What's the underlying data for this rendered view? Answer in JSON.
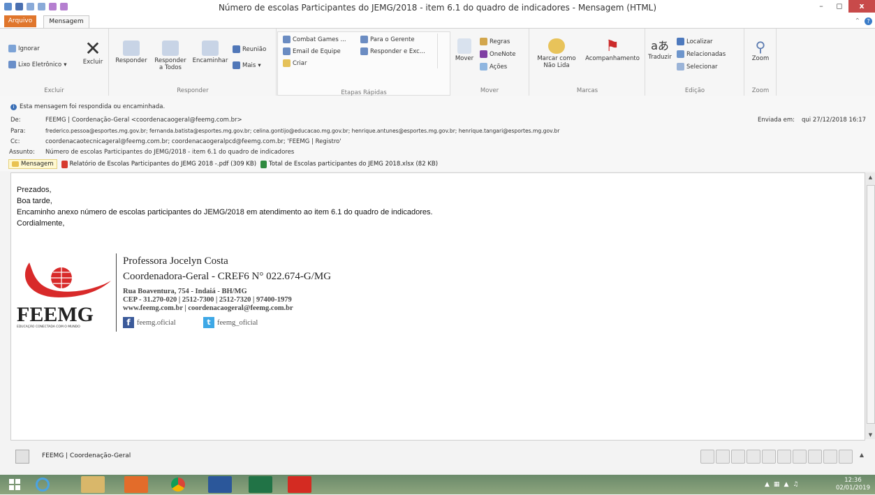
{
  "window": {
    "title": "Número de escolas Participantes do JEMG/2018 - item 6.1 do quadro de indicadores - Mensagem (HTML)",
    "close_label": "x"
  },
  "tabs": {
    "arquivo": "Arquivo",
    "mensagem": "Mensagem"
  },
  "ribbon": {
    "groups": {
      "excluir": "Excluir",
      "responder": "Responder",
      "etapas": "Etapas Rápidas",
      "mover": "Mover",
      "marcas": "Marcas",
      "edicao": "Edição",
      "zoom": "Zoom"
    },
    "ignorar": "Ignorar",
    "lixo": "Lixo Eletrônico",
    "excluir": "Excluir",
    "responder": "Responder",
    "responder_todos_1": "Responder",
    "responder_todos_2": "a Todos",
    "encaminhar": "Encaminhar",
    "reuniao": "Reunião",
    "mais": "Mais",
    "combat": "Combat Games ...",
    "email_equipe": "Email de Equipe",
    "criar": "Criar",
    "para_gerente": "Para o Gerente",
    "responder_exc": "Responder e Exc...",
    "mover": "Mover",
    "regras": "Regras",
    "onenote": "OneNote",
    "acoes": "Ações",
    "marcar_1": "Marcar como",
    "marcar_2": "Não Lida",
    "acompanhamento": "Acompanhamento",
    "traduzir": "Traduzir",
    "localizar": "Localizar",
    "relacionadas": "Relacionadas",
    "selecionar": "Selecionar",
    "zoom": "Zoom"
  },
  "header": {
    "info": "Esta mensagem foi respondida ou encaminhada.",
    "de_label": "De:",
    "de": "FEEMG | Coordenação-Geral <coordenacaogeral@feemg.com.br>",
    "enviada_label": "Enviada em:",
    "enviada": "qui 27/12/2018 16:17",
    "para_label": "Para:",
    "para": "frederico.pessoa@esportes.mg.gov.br; fernanda.batista@esportes.mg.gov.br; celina.gontijo@educacao.mg.gov.br; henrique.antunes@esportes.mg.gov.br; henrique.tangari@esportes.mg.gov.br",
    "cc_label": "Cc:",
    "cc": "coordenacaotecnicageral@feemg.com.br; coordenacaogeralpcd@feemg.com.br; 'FEEMG | Registro'",
    "assunto_label": "Assunto:",
    "assunto": "Número de escolas Participantes do JEMG/2018 - item 6.1 do quadro de indicadores"
  },
  "attachments": [
    "Mensagem",
    "Relatório de Escolas Participantes do JEMG 2018 -.pdf (309 KB)",
    "Total de Escolas participantes do JEMG 2018.xlsx (82 KB)"
  ],
  "body": {
    "line1": "Prezados,",
    "line2": "Boa tarde,",
    "line3": "Encaminho anexo número de escolas participantes do JEMG/2018 em atendimento ao item 6.1 do quadro de indicadores.",
    "line4": "Cordialmente,"
  },
  "signature": {
    "logo_text": "FEEMG",
    "logo_tagline": "EDUCAÇÃO CONECTADA COM O MUNDO",
    "name": "Professora Jocelyn Costa",
    "role": "Coordenadora-Geral - CREF6 N° 022.674-G/MG",
    "address": "Rua Boaventura, 754 - Indaiá - BH/MG",
    "phones": "CEP - 31.270-020 | 2512-7300 | 2512-7320 | 97400-1979",
    "web": "www.feemg.com.br | coordenacaogeral@feemg.com.br",
    "facebook": "feemg.oficial",
    "twitter": "feemg_oficial"
  },
  "people": {
    "name": "FEEMG | Coordenação-Geral"
  },
  "clock": {
    "time": "12:36",
    "date": "02/01/2019"
  }
}
